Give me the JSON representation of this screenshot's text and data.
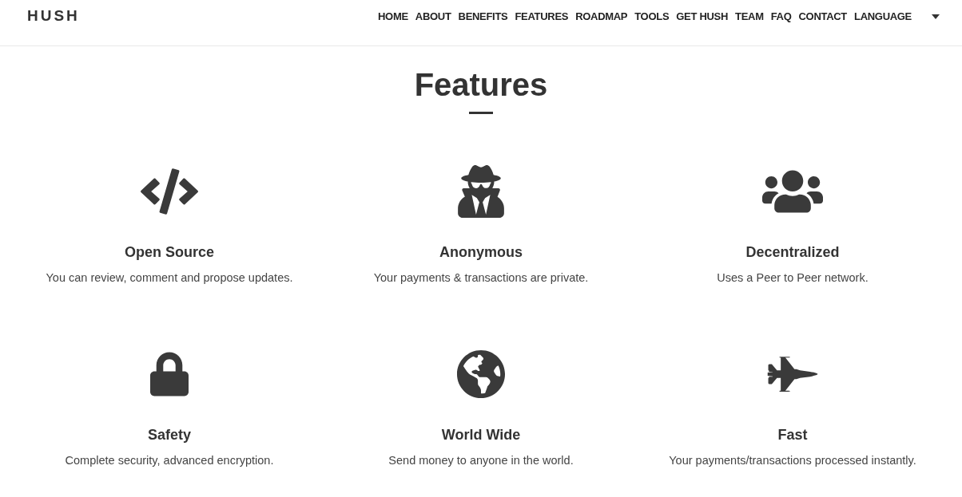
{
  "header": {
    "logo": "HUSH",
    "nav": [
      {
        "label": "HOME"
      },
      {
        "label": "ABOUT"
      },
      {
        "label": "BENEFITS"
      },
      {
        "label": "FEATURES"
      },
      {
        "label": "ROADMAP"
      },
      {
        "label": "TOOLS"
      },
      {
        "label": "GET HUSH"
      },
      {
        "label": "TEAM"
      },
      {
        "label": "FAQ"
      },
      {
        "label": "CONTACT"
      },
      {
        "label": "LANGUAGE"
      }
    ]
  },
  "section": {
    "title": "Features",
    "features": [
      {
        "kind": "code",
        "title": "Open Source",
        "description": "You can review, comment and propose updates."
      },
      {
        "kind": "spy",
        "title": "Anonymous",
        "description": "Your payments & transactions are private."
      },
      {
        "kind": "users",
        "title": "Decentralized",
        "description": "Uses a Peer to Peer network."
      },
      {
        "kind": "lock",
        "title": "Safety",
        "description": "Complete security, advanced encryption."
      },
      {
        "kind": "globe",
        "title": "World Wide",
        "description": "Send money to anyone in the world."
      },
      {
        "kind": "jet",
        "title": "Fast",
        "description": "Your payments/transactions processed instantly."
      }
    ]
  }
}
